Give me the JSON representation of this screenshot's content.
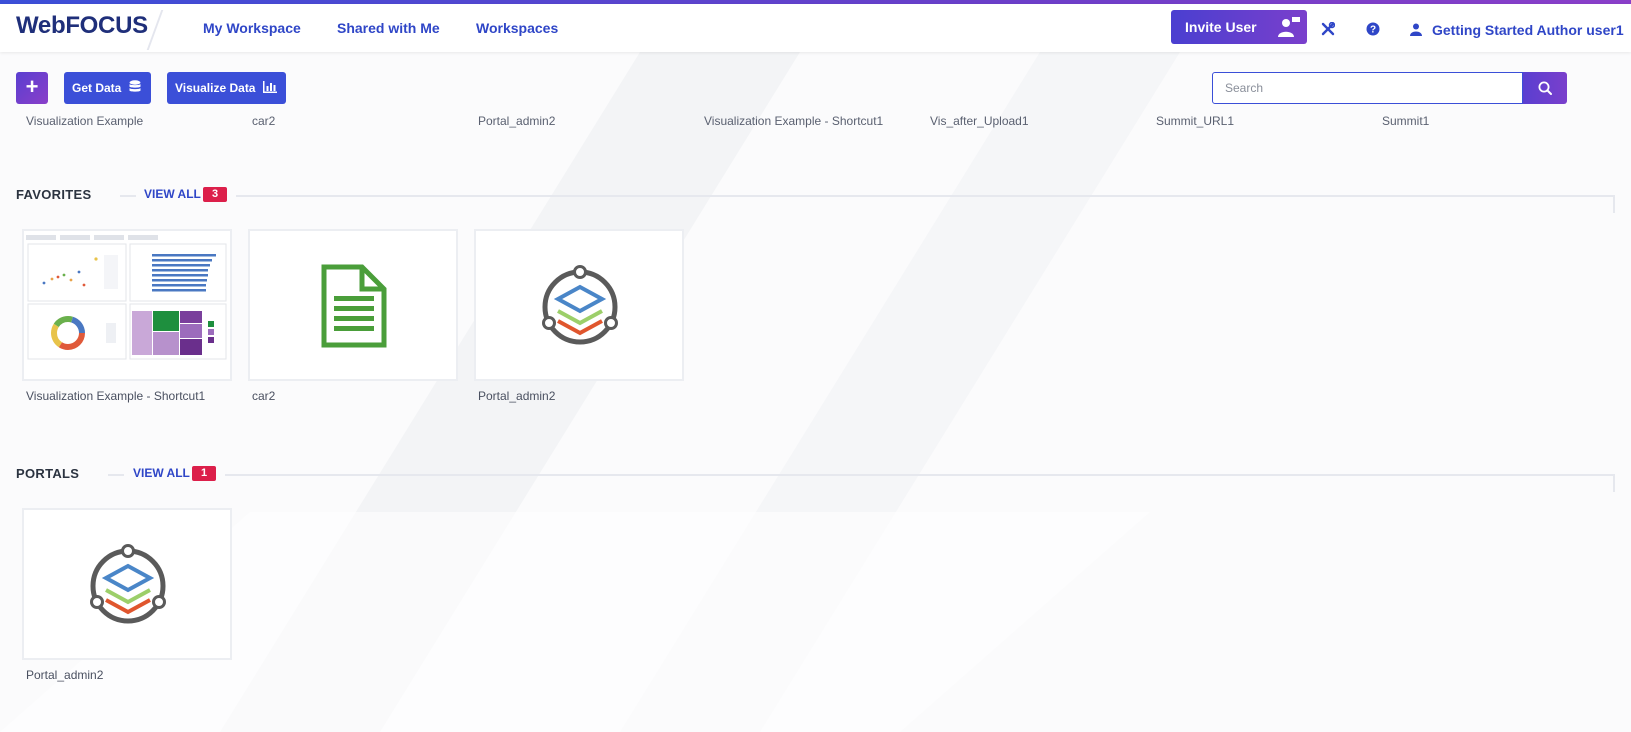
{
  "header": {
    "logo": "WebFOCUS",
    "nav": [
      "My Workspace",
      "Shared with Me",
      "Workspaces"
    ],
    "invite_label": "Invite User",
    "user_label": "Getting Started Author user1"
  },
  "toolbar": {
    "plus_label": "+",
    "get_data_label": "Get Data",
    "visualize_label": "Visualize Data",
    "search_placeholder": "Search"
  },
  "recents": [
    "Visualization Example",
    "car2",
    "Portal_admin2",
    "Visualization Example - Shortcut1",
    "Vis_after_Upload1",
    "Summit_URL1",
    "Summit1"
  ],
  "favorites": {
    "title": "FAVORITES",
    "view_all": "VIEW ALL",
    "count": "3",
    "items": [
      "Visualization Example - Shortcut1",
      "car2",
      "Portal_admin2"
    ]
  },
  "portals": {
    "title": "PORTALS",
    "view_all": "VIEW ALL",
    "count": "1",
    "items": [
      "Portal_admin2"
    ]
  },
  "colors": {
    "accent": "#3b4fd8",
    "brand_gradient_end": "#8a3fc9",
    "badge": "#dc1f4a",
    "doc_icon": "#4a9e3a"
  },
  "icons": [
    "person-flag-icon",
    "tools-icon",
    "help-icon",
    "user-icon",
    "database-icon",
    "bar-chart-icon",
    "search-icon",
    "document-icon",
    "portal-icon"
  ]
}
